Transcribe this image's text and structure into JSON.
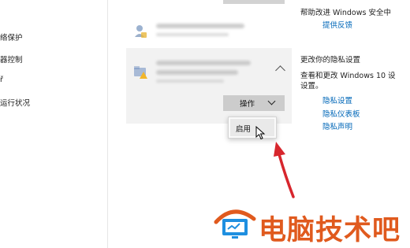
{
  "nav": {
    "items": [
      {
        "label": "络保护"
      },
      {
        "label": "器控制"
      },
      {
        "label": "ř"
      },
      {
        "label": "运行状况"
      }
    ]
  },
  "notifications": {
    "item2": {
      "action_button": {
        "label": "操作",
        "icon": "chevron-down-icon"
      },
      "expand_icon": "chevron-up-icon"
    }
  },
  "dropdown": {
    "items": [
      {
        "label": "启用"
      }
    ]
  },
  "right_panel": {
    "help_title": "帮助改进 Windows 安全中",
    "feedback_link": "提供反馈",
    "privacy_title": "更改你的隐私设置",
    "privacy_desc_line1": "查看和更改 Windows 10 设",
    "privacy_desc_line2": "设置。",
    "links": [
      {
        "label": "隐私设置"
      },
      {
        "label": "隐私仪表板"
      },
      {
        "label": "隐私声明"
      }
    ]
  },
  "watermark": {
    "text": "电脑技术吧"
  },
  "colors": {
    "link": "#0067b8",
    "watermark": "#e05a1e",
    "arrow": "#d7262d",
    "logo_blue": "#1f8fe0"
  }
}
